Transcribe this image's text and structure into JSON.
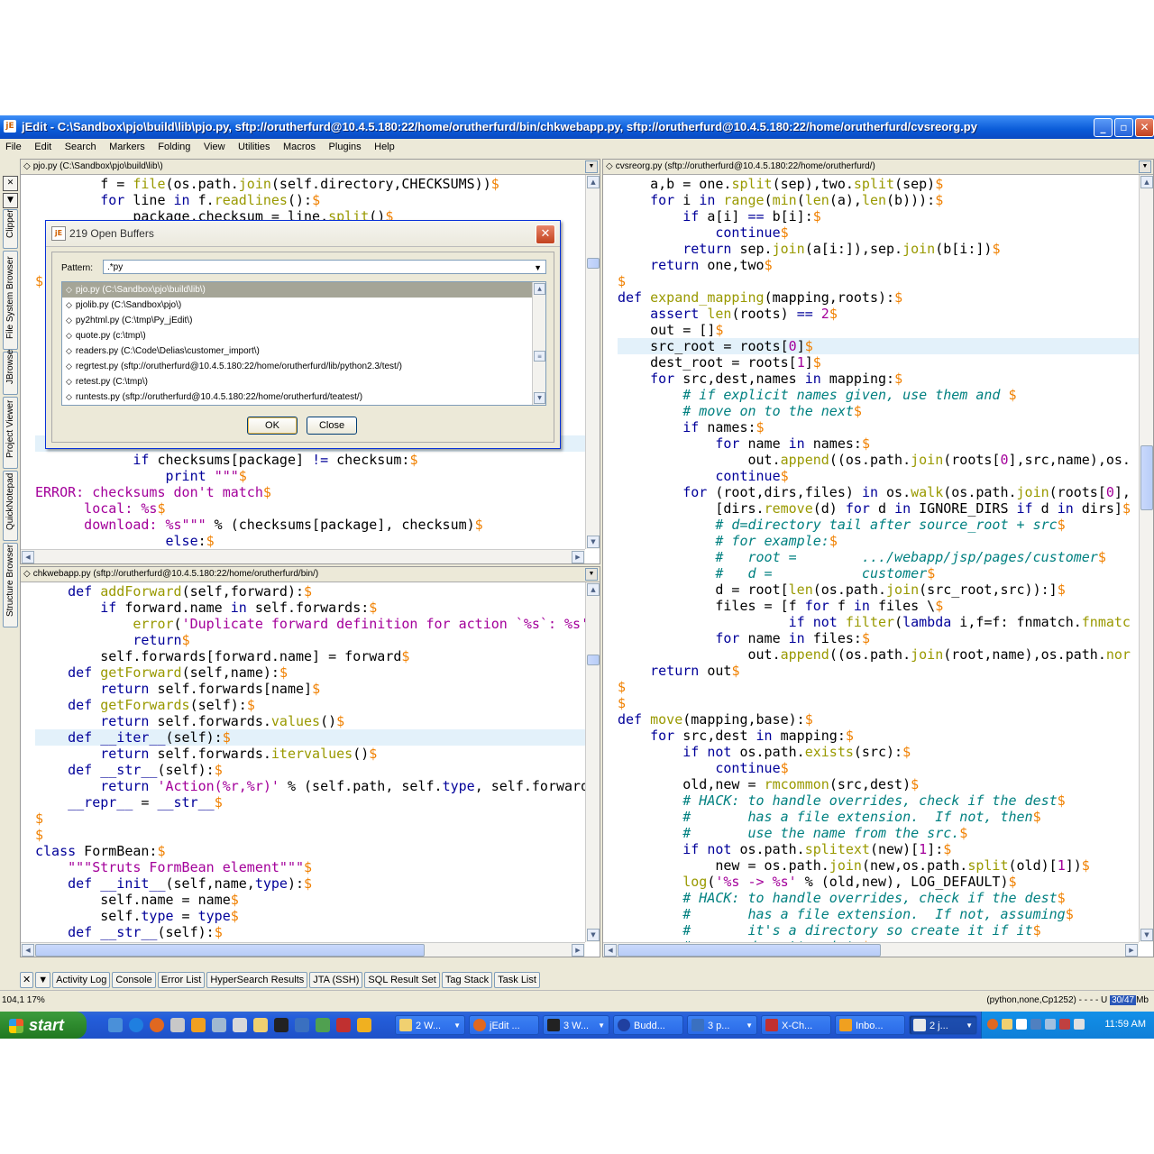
{
  "window": {
    "title": "jEdit - C:\\Sandbox\\pjo\\build\\lib\\pjo.py, sftp://orutherfurd@10.4.5.180:22/home/orutherfurd/bin/chkwebapp.py, sftp://orutherfurd@10.4.5.180:22/home/orutherfurd/cvsreorg.py",
    "icon_text": "jE"
  },
  "menu": [
    "File",
    "Edit",
    "Search",
    "Markers",
    "Folding",
    "View",
    "Utilities",
    "Macros",
    "Plugins",
    "Help"
  ],
  "left_dock_tabs": [
    "Clipper",
    "File System Browser",
    "JBrowse",
    "Project Viewer",
    "QuickNotepad",
    "Structure Browser"
  ],
  "panes": {
    "top_left": {
      "header": "pjo.py (C:\\Sandbox\\pjo\\build\\lib\\)"
    },
    "bottom_left": {
      "header": "chkwebapp.py (sftp://orutherfurd@10.4.5.180:22/home/orutherfurd/bin/)"
    },
    "right": {
      "header": "cvsreorg.py (sftp://orutherfurd@10.4.5.180:22/home/orutherfurd/)"
    }
  },
  "dialog": {
    "title": "219 Open Buffers",
    "pattern_label": "Pattern:",
    "pattern_value": ".*py",
    "buffers": [
      "pjo.py (C:\\Sandbox\\pjo\\build\\lib\\)",
      "pjolib.py (C:\\Sandbox\\pjo\\)",
      "py2html.py (C:\\tmp\\Py_jEdit\\)",
      "quote.py (c:\\tmp\\)",
      "readers.py (C:\\Code\\Delias\\customer_import\\)",
      "regrtest.py (sftp://orutherfurd@10.4.5.180:22/home/orutherfurd/lib/python2.3/test/)",
      "retest.py (C:\\tmp\\)",
      "runtests.py (sftp://orutherfurd@10.4.5.180:22/home/orutherfurd/teatest/)"
    ],
    "ok_label": "OK",
    "close_label": "Close"
  },
  "bottom_tabs": [
    "Activity Log",
    "Console",
    "Error List",
    "HyperSearch Results",
    "JTA (SSH)",
    "SQL Result Set",
    "Tag Stack",
    "Task List"
  ],
  "status": {
    "left": "104,1 17%",
    "right": "(python,none,Cp1252) - - - - U",
    "memory": "30/47",
    "memory_unit": "Mb"
  },
  "taskbar": {
    "start_label": "start",
    "tasks": [
      "2 W...",
      "jEdit ...",
      "3 W...",
      "Budd...",
      "3 p...",
      "X-Ch...",
      "Inbo...",
      "2 j..."
    ],
    "clock": "11:59 AM"
  }
}
